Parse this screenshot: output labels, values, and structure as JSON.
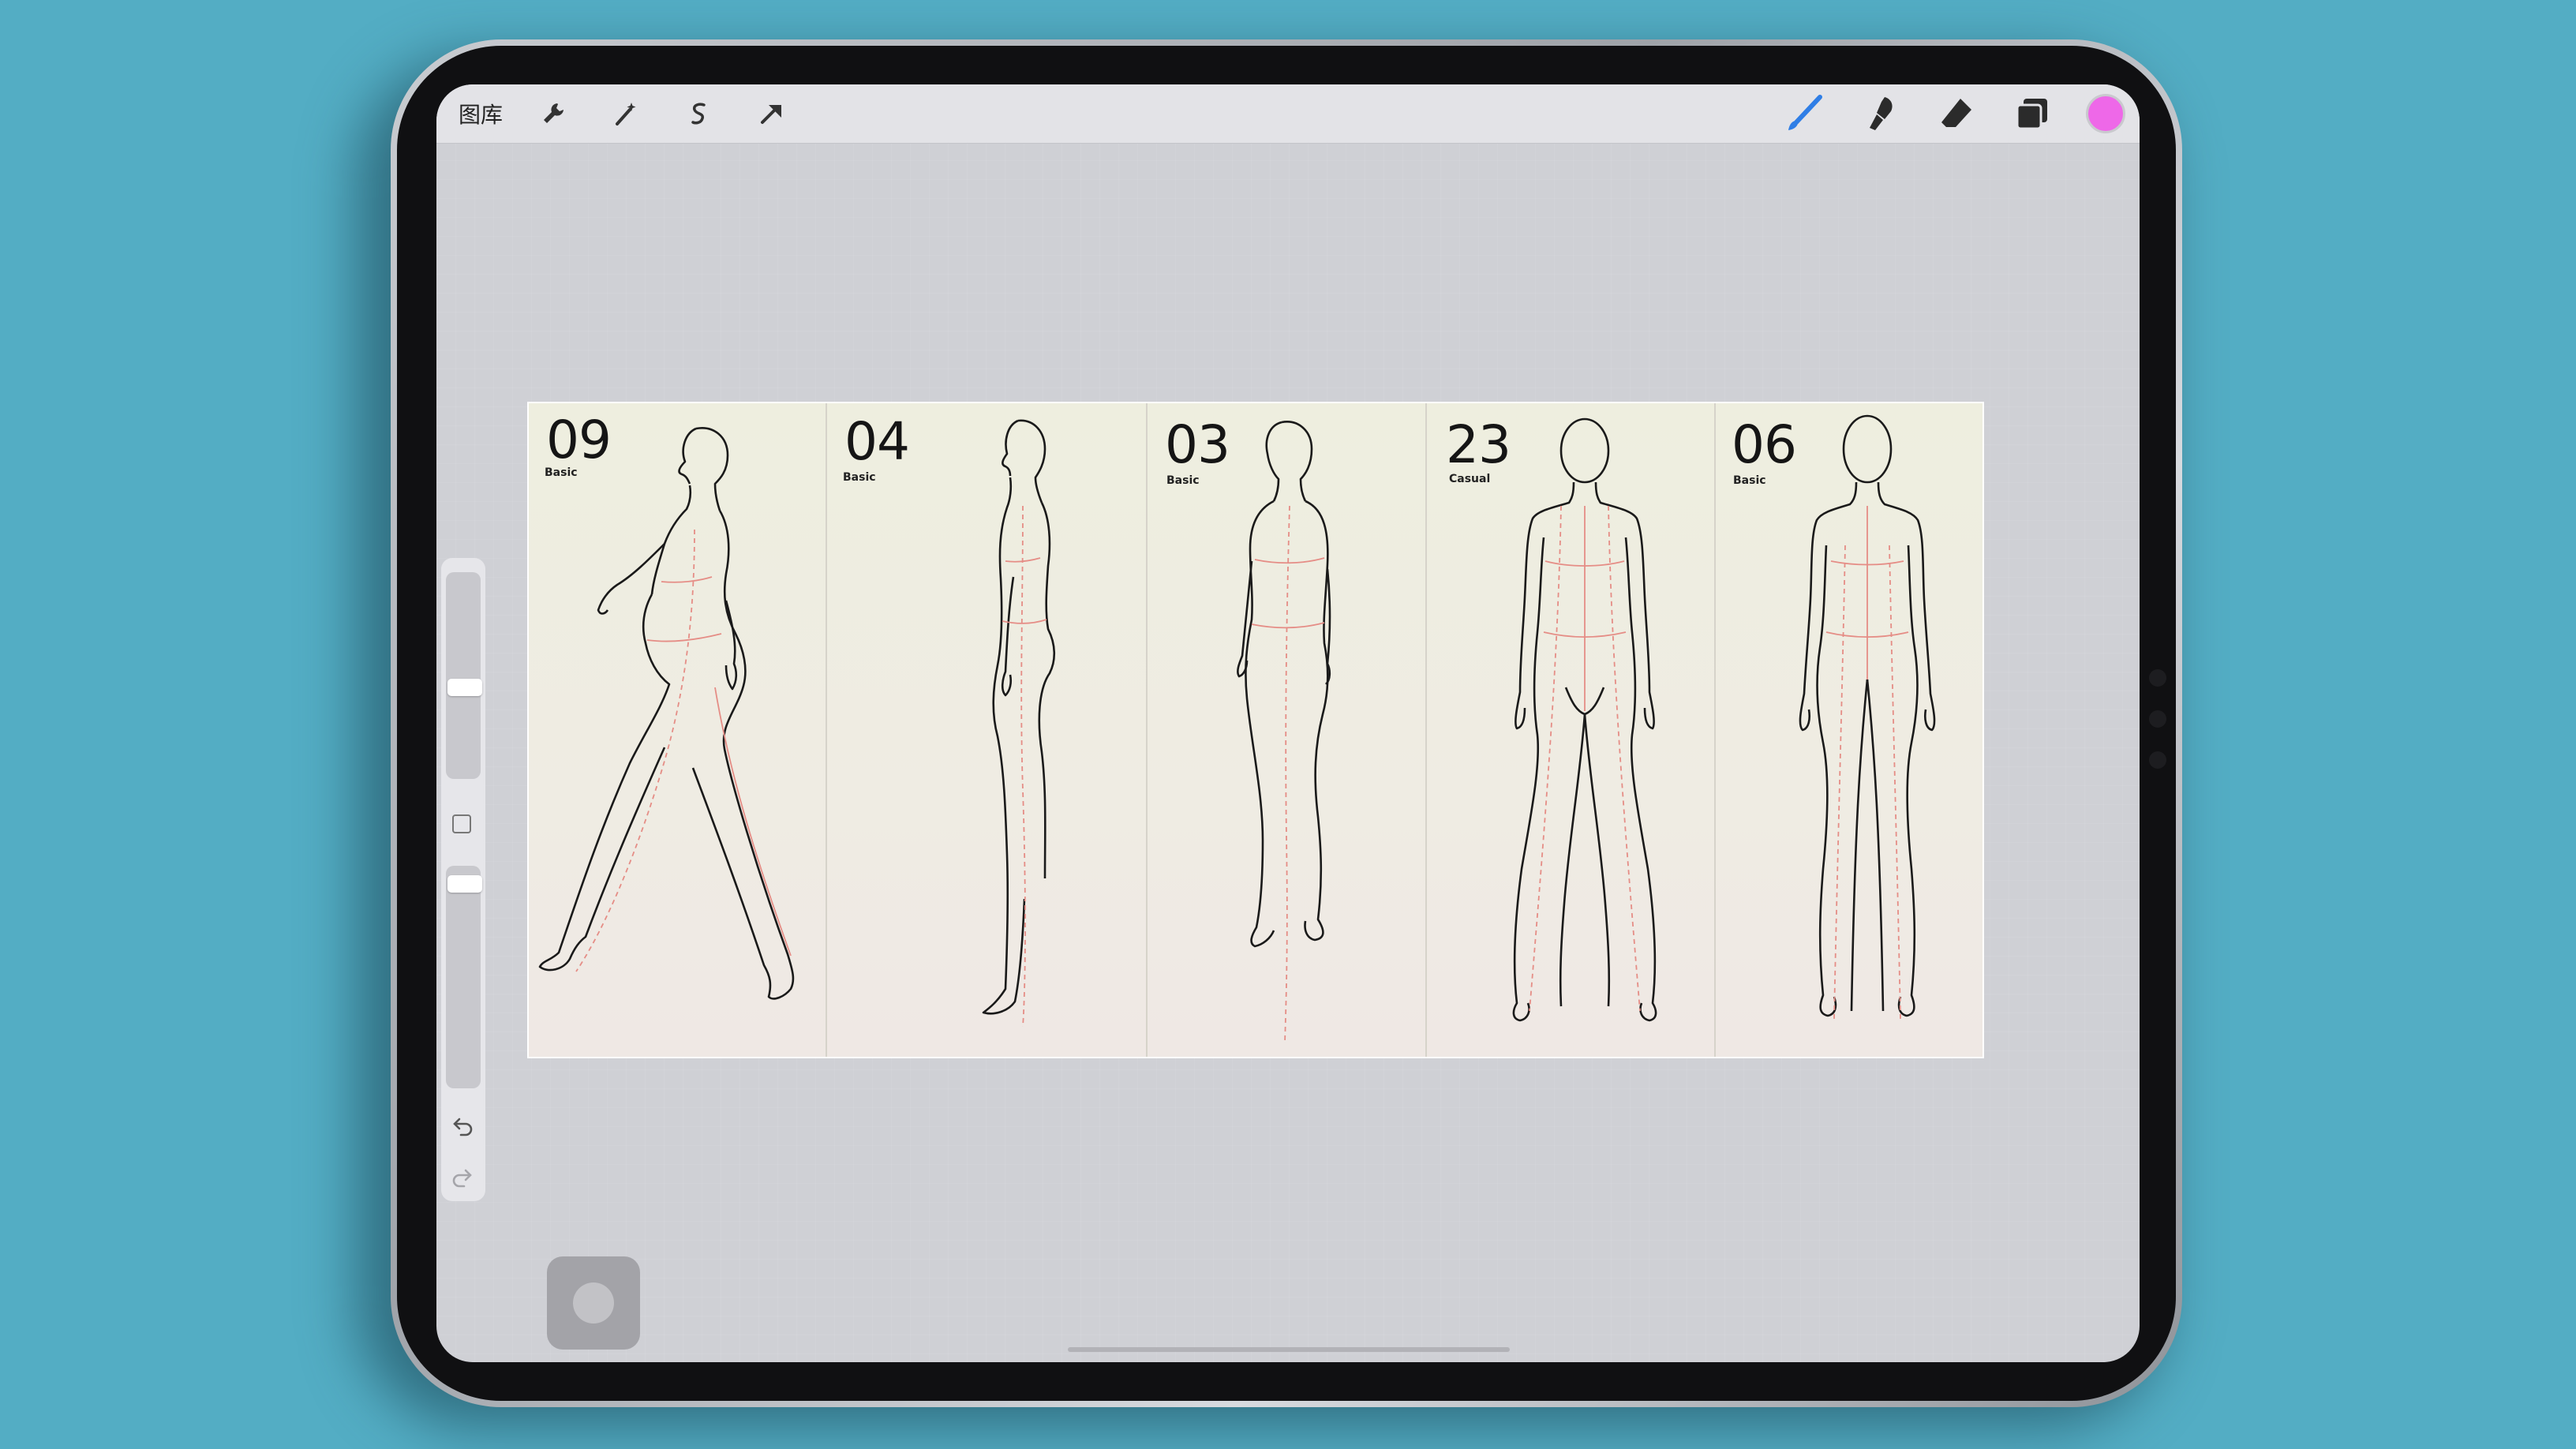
{
  "toolbar": {
    "gallery_label": "图库",
    "left_tools": [
      "wrench-icon",
      "magic-wand-icon",
      "selection-icon",
      "transform-arrow-icon"
    ],
    "right_tools": [
      "brush-icon",
      "smudge-icon",
      "eraser-icon",
      "layers-icon",
      "color-swatch"
    ],
    "active_color": "#ee68e8",
    "active_tool_color": "#2f7ee6"
  },
  "sidebar": {
    "brush_size_level": 0.55,
    "opacity_level": 0.95
  },
  "canvas": {
    "panels": [
      {
        "number": "09",
        "tag": "Basic"
      },
      {
        "number": "04",
        "tag": "Basic"
      },
      {
        "number": "03",
        "tag": "Basic"
      },
      {
        "number": "23",
        "tag": "Casual"
      },
      {
        "number": "06",
        "tag": "Basic"
      }
    ]
  },
  "colors": {
    "background": "#53adc4",
    "screen": "#cfd0d5",
    "toolbar": "#e3e3e7",
    "guide_lines": "#e58d86"
  }
}
